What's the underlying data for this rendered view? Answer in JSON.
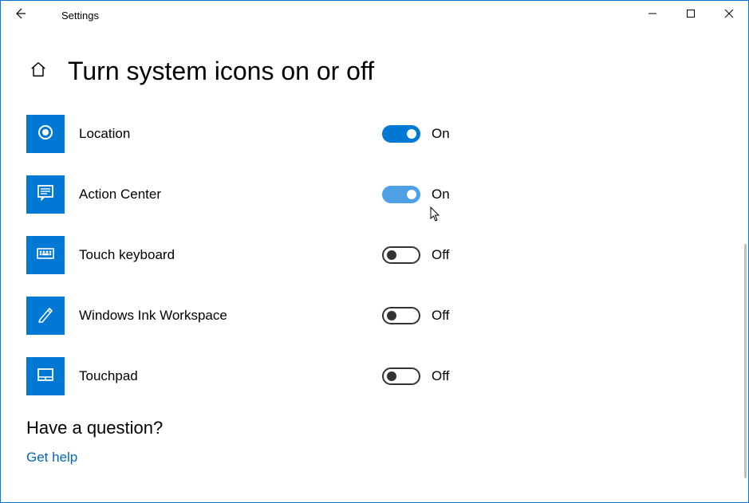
{
  "window": {
    "title": "Settings"
  },
  "page": {
    "title": "Turn system icons on or off"
  },
  "toggle_labels": {
    "on": "On",
    "off": "Off"
  },
  "items": [
    {
      "icon": "location-icon",
      "label": "Location",
      "state": "on",
      "hover": false
    },
    {
      "icon": "action-center-icon",
      "label": "Action Center",
      "state": "on",
      "hover": true
    },
    {
      "icon": "touch-keyboard-icon",
      "label": "Touch keyboard",
      "state": "off",
      "hover": false
    },
    {
      "icon": "ink-workspace-icon",
      "label": "Windows Ink Workspace",
      "state": "off",
      "hover": false
    },
    {
      "icon": "touchpad-icon",
      "label": "Touchpad",
      "state": "off",
      "hover": false
    }
  ],
  "footer": {
    "heading": "Have a question?",
    "link": "Get help"
  },
  "colors": {
    "accent": "#0078d4",
    "link": "#0067c0"
  }
}
